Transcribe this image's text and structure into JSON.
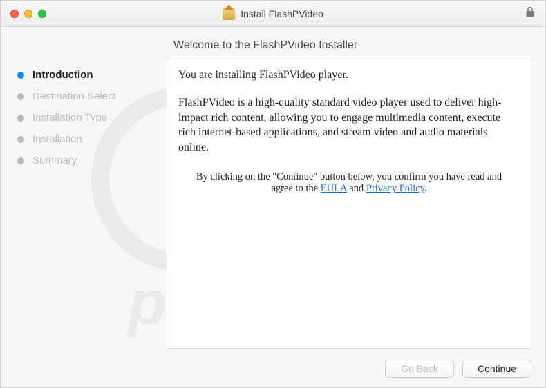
{
  "titlebar": {
    "title": "Install FlashPVideo"
  },
  "header": {
    "welcome": "Welcome to the FlashPVideo Installer"
  },
  "sidebar": {
    "steps": [
      {
        "label": "Introduction",
        "active": true
      },
      {
        "label": "Destination Select",
        "active": false
      },
      {
        "label": "Installation Type",
        "active": false
      },
      {
        "label": "Installation",
        "active": false
      },
      {
        "label": "Summary",
        "active": false
      }
    ]
  },
  "content": {
    "intro": "You are installing FlashPVideo player.",
    "desc": "FlashPVideo is a high-quality standard video player used to deliver high-impact rich content, allowing you to engage multimedia content, execute rich internet-based applications, and stream video and audio materials online.",
    "agree_pre": "By clicking on the \"Continue\" button below, you confirm you have read and agree to the ",
    "eula_label": "EULA",
    "agree_mid": " and ",
    "privacy_label": "Privacy Policy",
    "agree_post": "."
  },
  "buttons": {
    "go_back": "Go Back",
    "continue": "Continue"
  },
  "watermark": {
    "text": "pcrisk.com"
  }
}
